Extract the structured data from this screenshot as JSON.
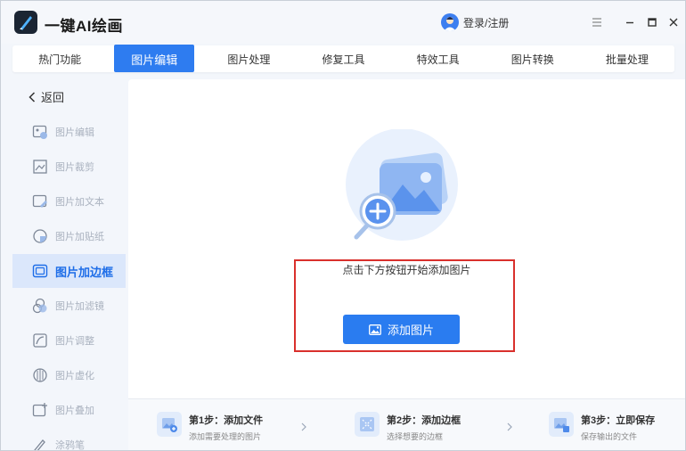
{
  "app": {
    "title": "一键AI绘画",
    "login_label": "登录/注册"
  },
  "tabs": [
    {
      "label": "热门功能"
    },
    {
      "label": "图片编辑",
      "active": true
    },
    {
      "label": "图片处理"
    },
    {
      "label": "修复工具"
    },
    {
      "label": "特效工具"
    },
    {
      "label": "图片转换"
    },
    {
      "label": "批量处理"
    }
  ],
  "sidebar": {
    "back_label": "返回",
    "items": [
      {
        "label": "图片编辑",
        "icon": "image-edit-icon"
      },
      {
        "label": "图片裁剪",
        "icon": "crop-icon"
      },
      {
        "label": "图片加文本",
        "icon": "image-text-icon"
      },
      {
        "label": "图片加贴纸",
        "icon": "sticker-icon"
      },
      {
        "label": "图片加边框",
        "icon": "frame-icon",
        "active": true
      },
      {
        "label": "图片加滤镜",
        "icon": "filter-icon"
      },
      {
        "label": "图片调整",
        "icon": "adjust-icon"
      },
      {
        "label": "图片虚化",
        "icon": "blur-icon"
      },
      {
        "label": "图片叠加",
        "icon": "overlay-icon"
      },
      {
        "label": "涂鸦笔",
        "icon": "brush-icon"
      }
    ]
  },
  "main": {
    "prompt": "点击下方按钮开始添加图片",
    "add_button_label": "添加图片"
  },
  "steps": [
    {
      "title": "第1步：添加文件",
      "desc": "添加需要处理的图片"
    },
    {
      "title": "第2步：添加边框",
      "desc": "选择想要的边框"
    },
    {
      "title": "第3步：立即保存",
      "desc": "保存输出的文件"
    }
  ],
  "colors": {
    "accent": "#2a7cf0",
    "highlight": "#d9302c",
    "sidebar_active_bg": "#dbe7fb"
  }
}
